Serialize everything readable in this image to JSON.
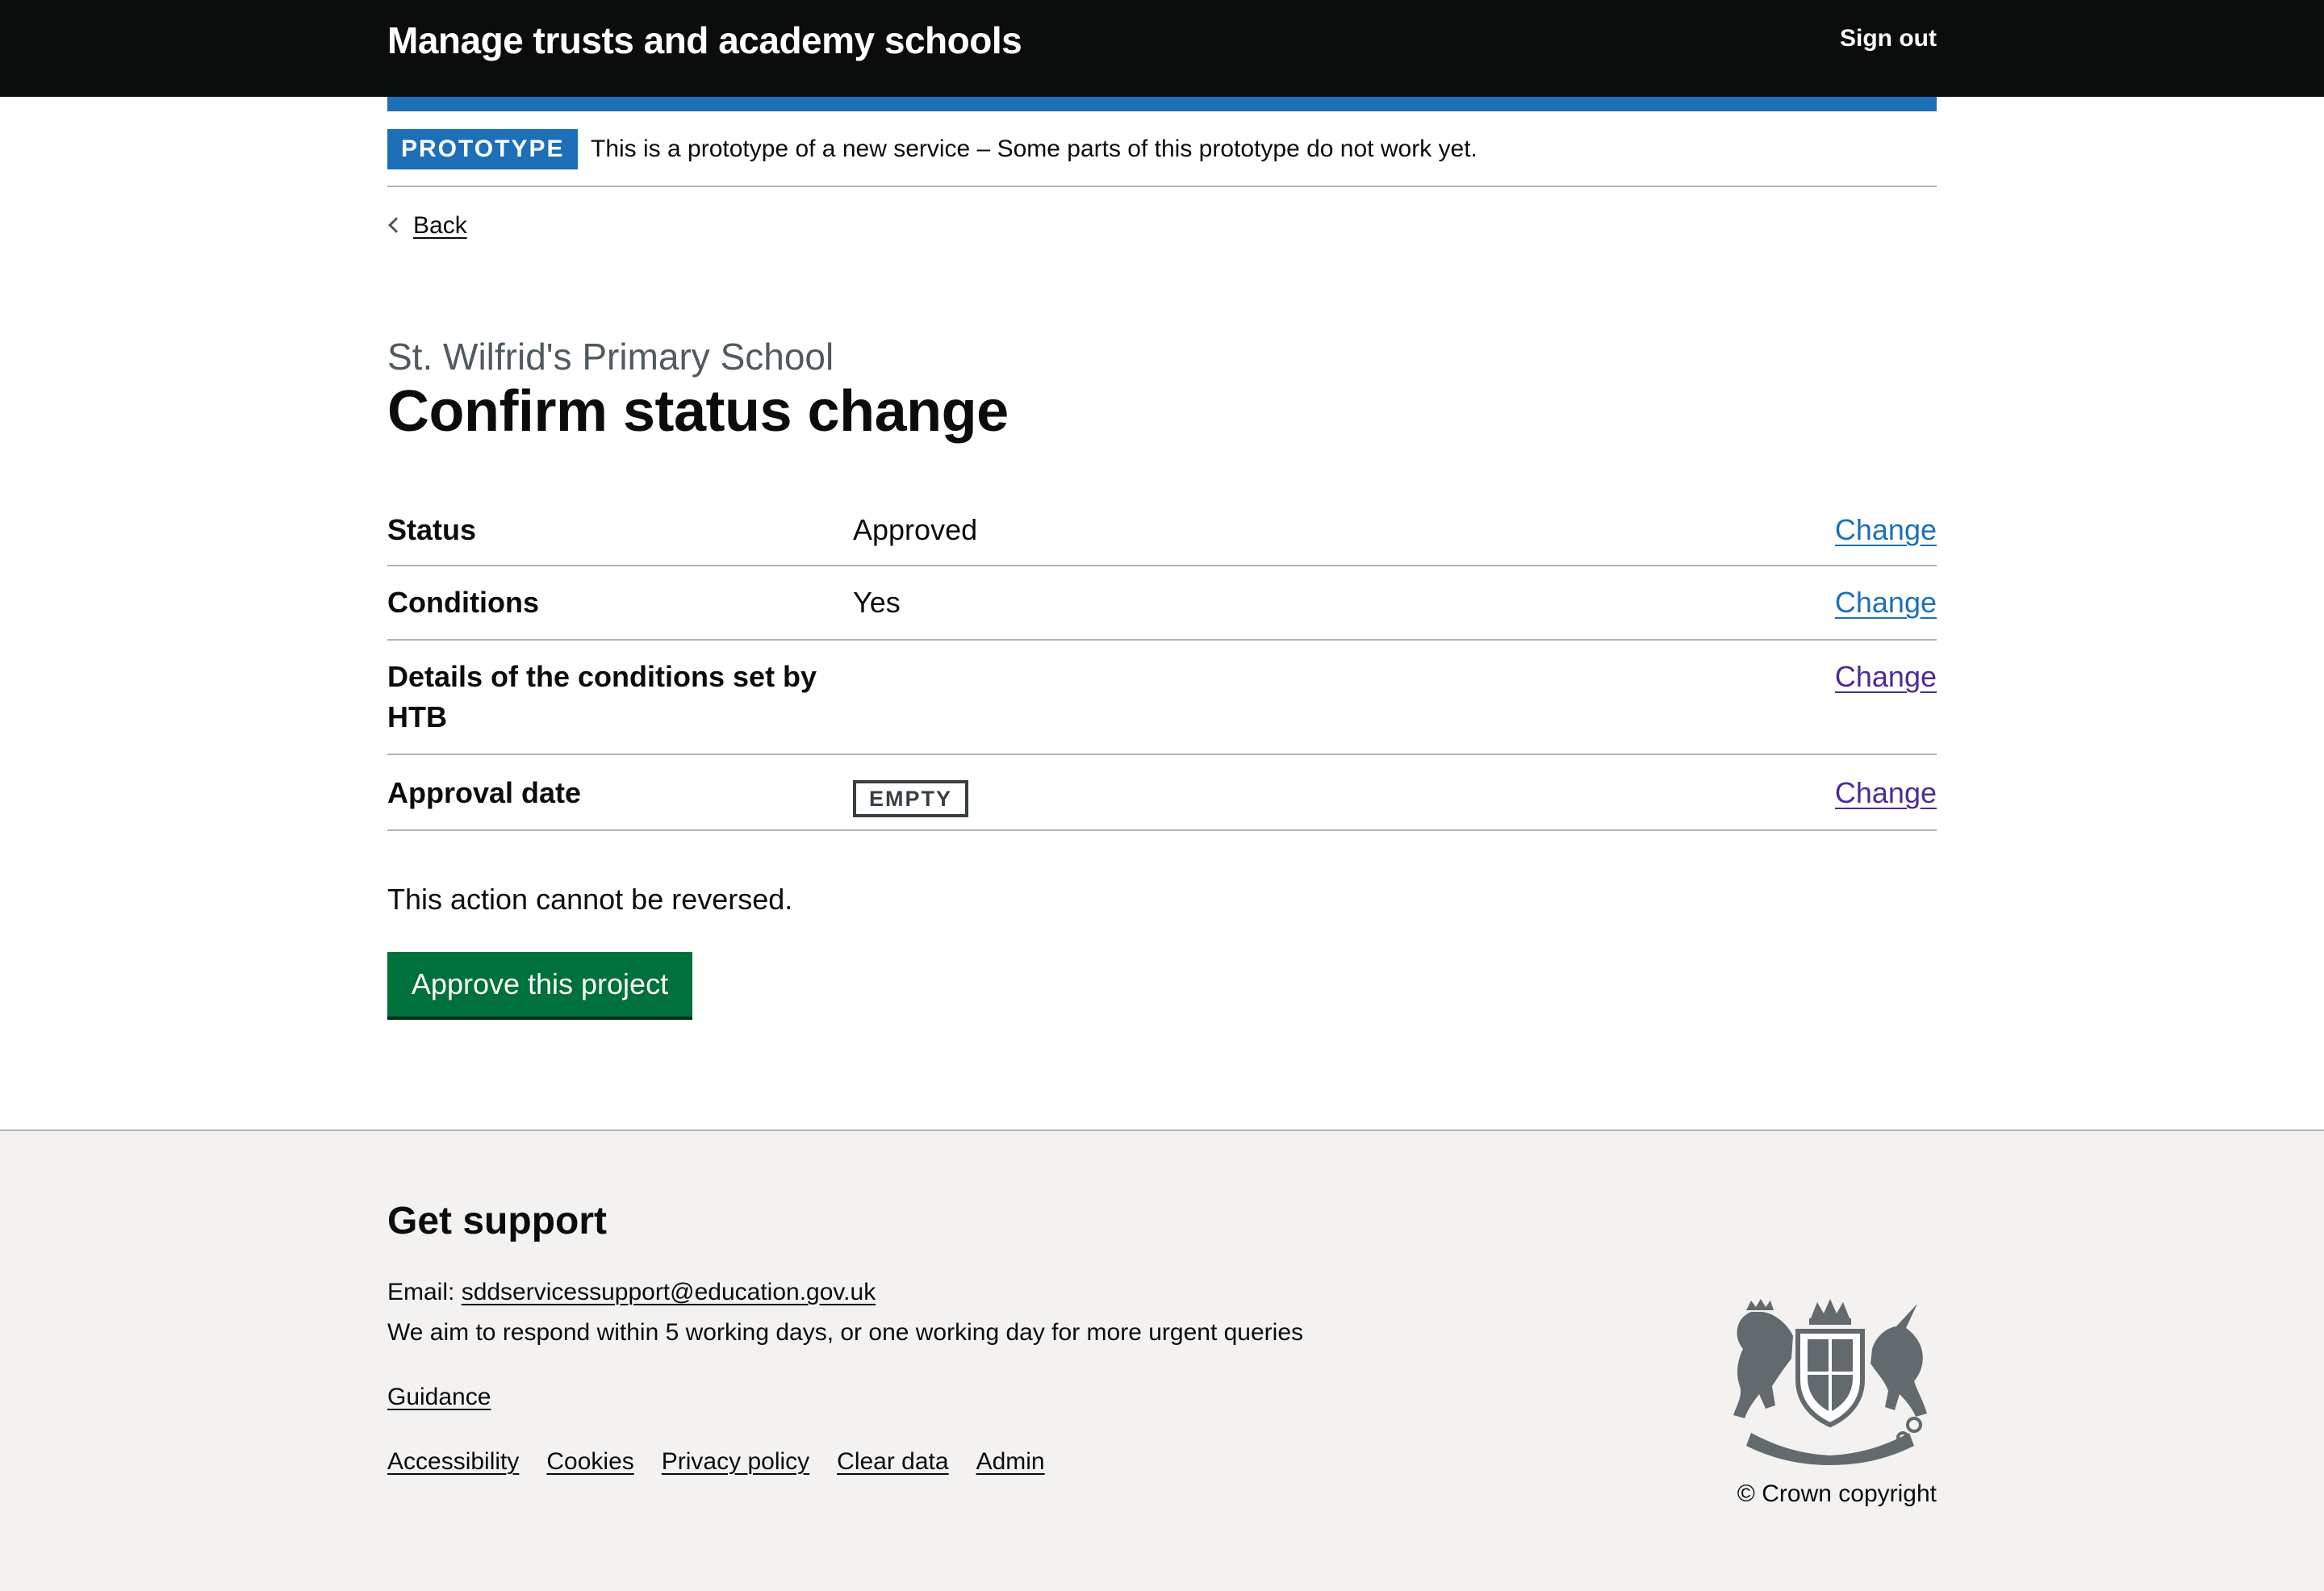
{
  "header": {
    "service_name": "Manage trusts and academy schools",
    "sign_out": "Sign out"
  },
  "phase_banner": {
    "tag": "PROTOTYPE",
    "text": "This is a prototype of a new service – Some parts of this prototype do not work yet."
  },
  "back_link": "Back",
  "page": {
    "caption": "St. Wilfrid's Primary School",
    "title": "Confirm status change"
  },
  "summary": {
    "rows": [
      {
        "key": "Status",
        "value": "Approved",
        "action": "Change"
      },
      {
        "key": "Conditions",
        "value": "Yes",
        "action": "Change"
      },
      {
        "key": "Details of the conditions set by HTB",
        "value": "",
        "action": "Change"
      },
      {
        "key": "Approval date",
        "value_tag": "EMPTY",
        "action": "Change"
      }
    ]
  },
  "warning_text": "This action cannot be reversed.",
  "submit_button": "Approve this project",
  "footer": {
    "heading": "Get support",
    "email_label": "Email: ",
    "email": "sddservicessupport@education.gov.uk",
    "response_text": "We aim to respond within 5 working days, or one working day for more urgent queries",
    "guidance": "Guidance",
    "links": [
      "Accessibility",
      "Cookies",
      "Privacy policy",
      "Clear data",
      "Admin"
    ],
    "copyright": "© Crown copyright",
    "crest_icon": "royal-coat-of-arms-icon"
  },
  "colors": {
    "header_bg": "#0b0c0c",
    "brand_blue": "#1d70b8",
    "button_green": "#00703c",
    "footer_bg": "#f3f2f1",
    "visited_link": "#4c2c92"
  }
}
